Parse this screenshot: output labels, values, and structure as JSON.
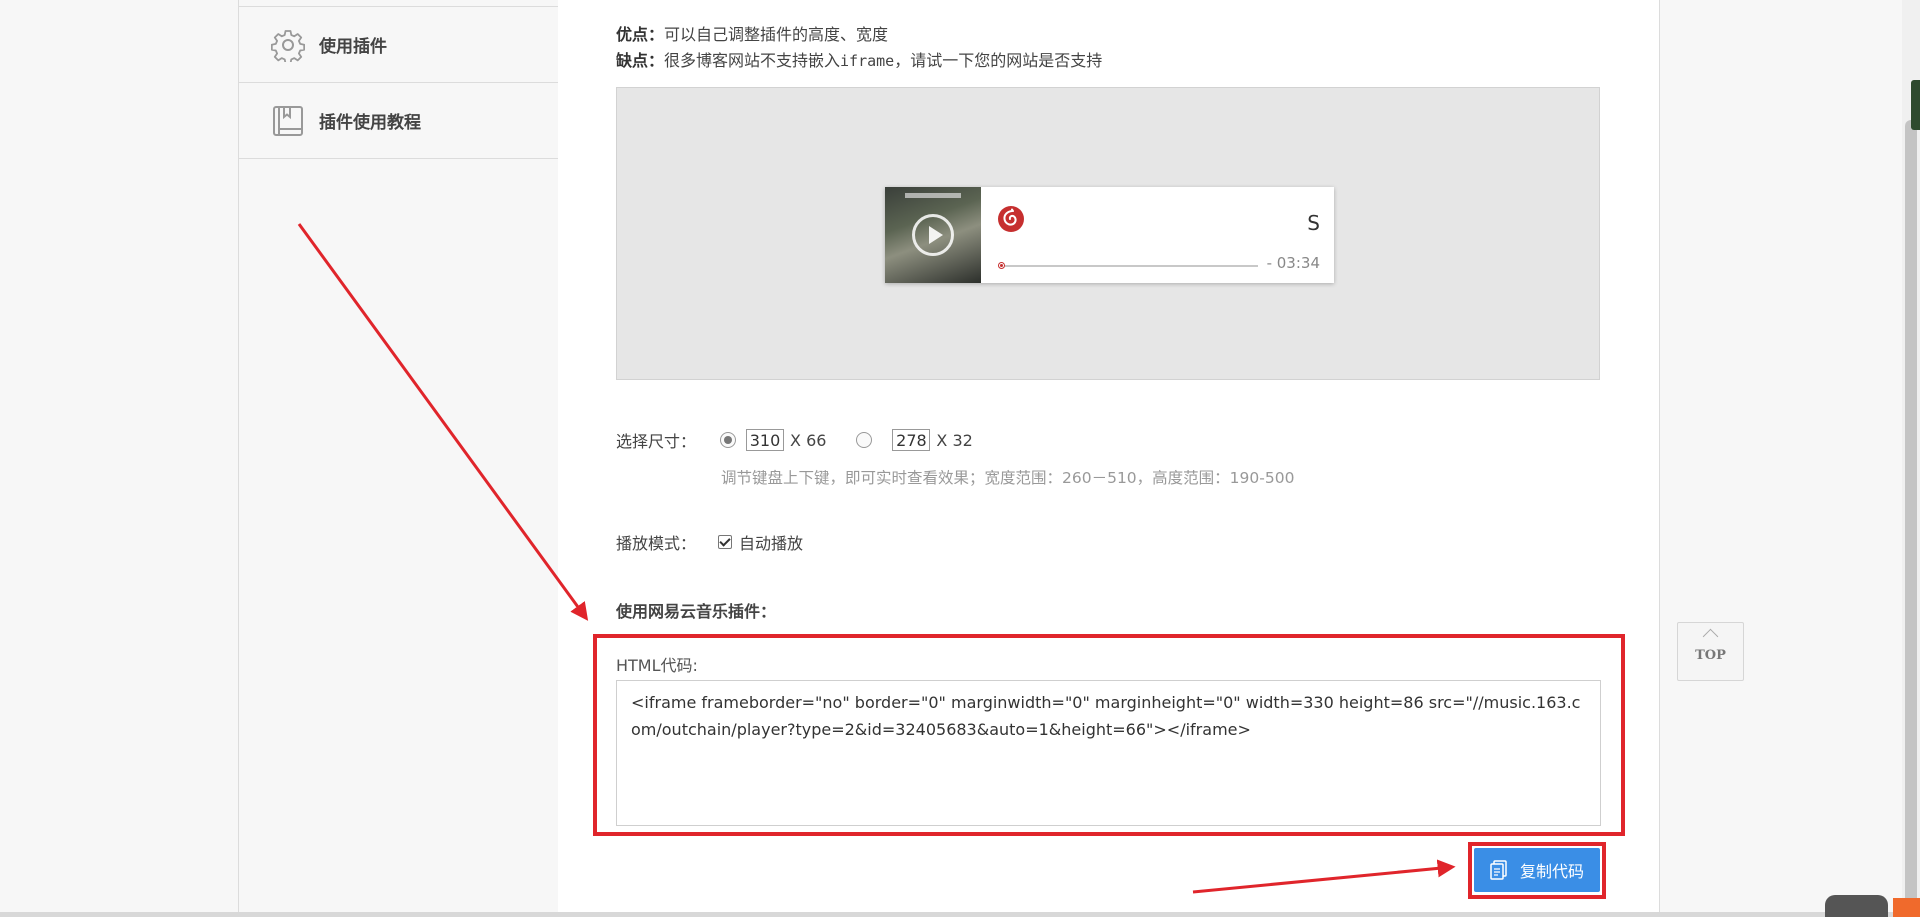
{
  "sidebar": {
    "items": [
      {
        "label": "使用插件",
        "icon": "gear-icon"
      },
      {
        "label": "插件使用教程",
        "icon": "book-icon"
      }
    ]
  },
  "main": {
    "pros_label": "优点：",
    "pros_text": "可以自己调整插件的高度、宽度",
    "cons_label": "缺点：",
    "cons_text_a": "很多博客网站不支持嵌入",
    "cons_text_mono": "iframe",
    "cons_text_b": "，请试一下您的网站是否支持"
  },
  "player": {
    "title": "S",
    "time": "- 03:34",
    "brand_color": "#c62f2f"
  },
  "size": {
    "label": "选择尺寸：",
    "option1_width": "310",
    "option1_height": "X 66",
    "option2_width": "278",
    "option2_height": "X 32",
    "hint": "调节键盘上下键，即可实时查看效果；宽度范围：260－510，高度范围：190-500"
  },
  "mode": {
    "label": "播放模式：",
    "autoplay_label": "自动播放",
    "autoplay_checked": true
  },
  "plugin": {
    "title": "使用网易云音乐插件：",
    "code_label": "HTML代码:",
    "code": "<iframe frameborder=\"no\" border=\"0\" marginwidth=\"0\" marginheight=\"0\" width=330 height=86 src=\"//music.163.com/outchain/player?type=2&id=32405683&auto=1&height=66\"></iframe>",
    "copy_label": "复制代码"
  },
  "top_button": "TOP",
  "colors": {
    "accent_blue": "#3a8ee6",
    "annotation_red": "#e0252b"
  }
}
